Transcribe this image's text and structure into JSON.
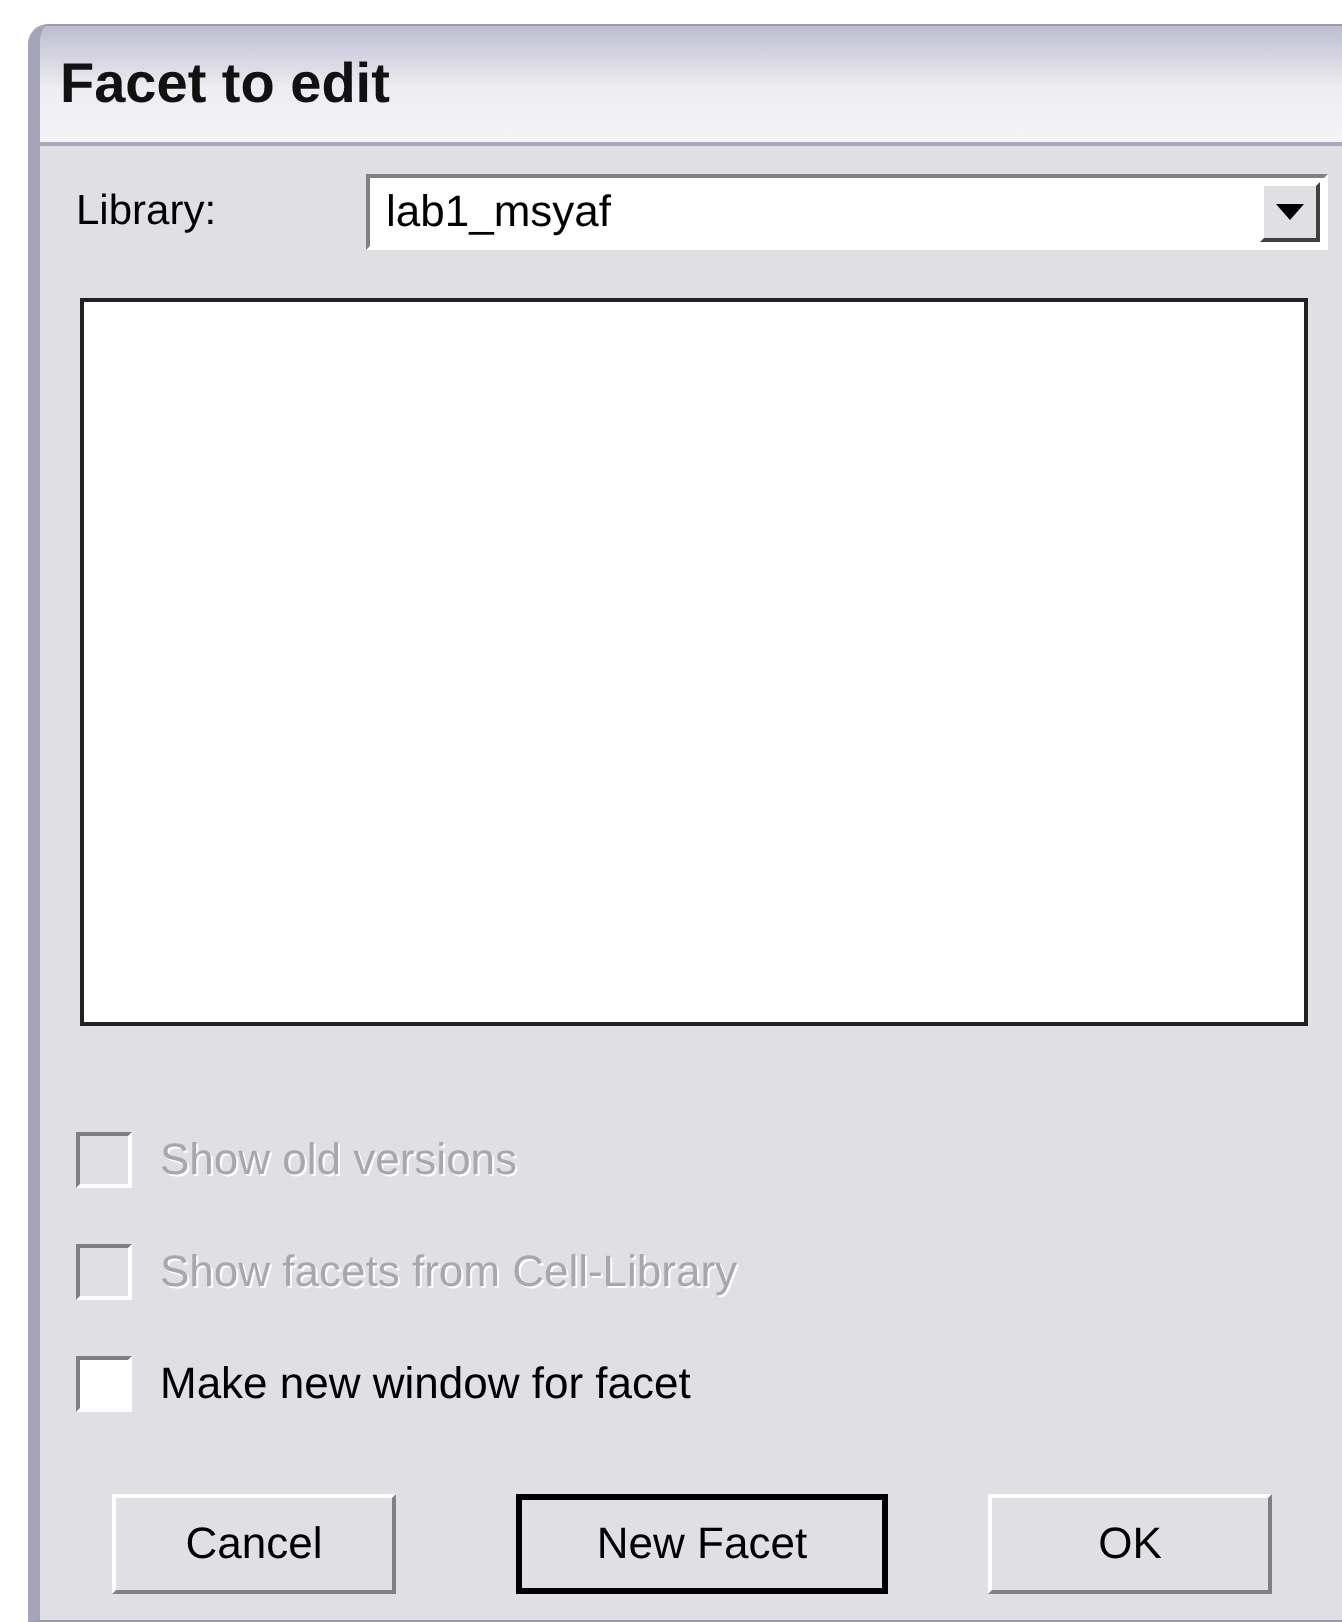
{
  "window": {
    "title": "Facet to edit"
  },
  "library": {
    "label": "Library:",
    "value": "lab1_msyaf"
  },
  "options": [
    {
      "label": "Show old versions",
      "checked": false,
      "disabled": true
    },
    {
      "label": "Show facets from Cell-Library",
      "checked": false,
      "disabled": true
    },
    {
      "label": "Make new window for facet",
      "checked": false,
      "disabled": false
    }
  ],
  "buttons": [
    {
      "label": "Cancel",
      "default": false
    },
    {
      "label": "New Facet",
      "default": true
    },
    {
      "label": "OK",
      "default": false
    }
  ]
}
